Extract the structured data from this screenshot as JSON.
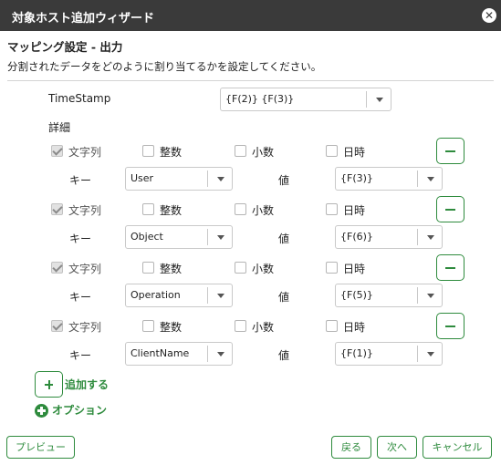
{
  "window": {
    "title": "対象ホスト追加ウィザード",
    "close_glyph": "✕"
  },
  "section": {
    "title": "マッピング設定 - 出力",
    "description": "分割されたデータをどのように割り当てるかを設定してください。"
  },
  "timestamp": {
    "label": "TimeStamp",
    "value": "{F(2)} {F(3)}"
  },
  "details_label": "詳細",
  "type_labels": {
    "string": "文字列",
    "integer": "整数",
    "decimal": "小数",
    "datetime": "日時"
  },
  "key_label": "キー",
  "value_label": "値",
  "mappings": [
    {
      "string_checked": true,
      "integer_checked": false,
      "decimal_checked": false,
      "datetime_checked": false,
      "key": "User",
      "value": "{F(3)}"
    },
    {
      "string_checked": true,
      "integer_checked": false,
      "decimal_checked": false,
      "datetime_checked": false,
      "key": "Object",
      "value": "{F(6)}"
    },
    {
      "string_checked": true,
      "integer_checked": false,
      "decimal_checked": false,
      "datetime_checked": false,
      "key": "Operation",
      "value": "{F(5)}"
    },
    {
      "string_checked": true,
      "integer_checked": false,
      "decimal_checked": false,
      "datetime_checked": false,
      "key": "ClientName",
      "value": "{F(1)}"
    }
  ],
  "add_label": "追加する",
  "options_label": "オプション",
  "footer": {
    "preview": "プレビュー",
    "back": "戻る",
    "next": "次へ",
    "cancel": "キャンセル"
  },
  "colors": {
    "accent": "#2e8b3d",
    "titlebar": "#3a3a3a"
  },
  "icons": {
    "close": "close-icon",
    "remove": "minus-icon",
    "add": "plus-icon",
    "options": "plus-circle-icon",
    "dropdown": "chevron-down-icon"
  }
}
